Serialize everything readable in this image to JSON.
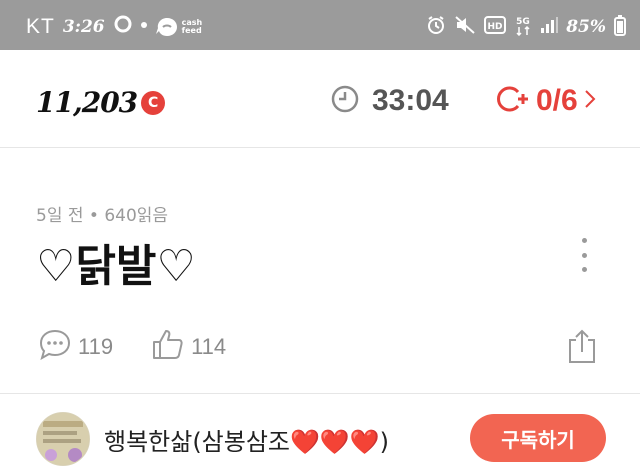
{
  "status_bar": {
    "carrier": "KT",
    "time": "3:26",
    "app_logo_text": "cash\nfeed",
    "battery_percent": "85%"
  },
  "header": {
    "coins": "11,203",
    "coin_symbol": "C",
    "timer": "33:04",
    "mission_progress": "0/6"
  },
  "post": {
    "meta": "5일 전 • 640읽음",
    "title": "♡닭발♡",
    "comments": "119",
    "likes": "114"
  },
  "author": {
    "name": "행복한삶(삼봉삼조❤️❤️❤️)",
    "follow_label": "구독하기"
  },
  "colors": {
    "accent": "#e5413b",
    "follow_button": "#f26552",
    "status_bar": "#9b9b9b"
  },
  "icons": [
    "alarm-icon",
    "mute-icon",
    "hd-icon",
    "5g-icon",
    "signal-icon",
    "battery-icon",
    "clock-icon",
    "coin-plus-icon",
    "comment-icon",
    "like-icon",
    "share-icon",
    "more-icon"
  ]
}
